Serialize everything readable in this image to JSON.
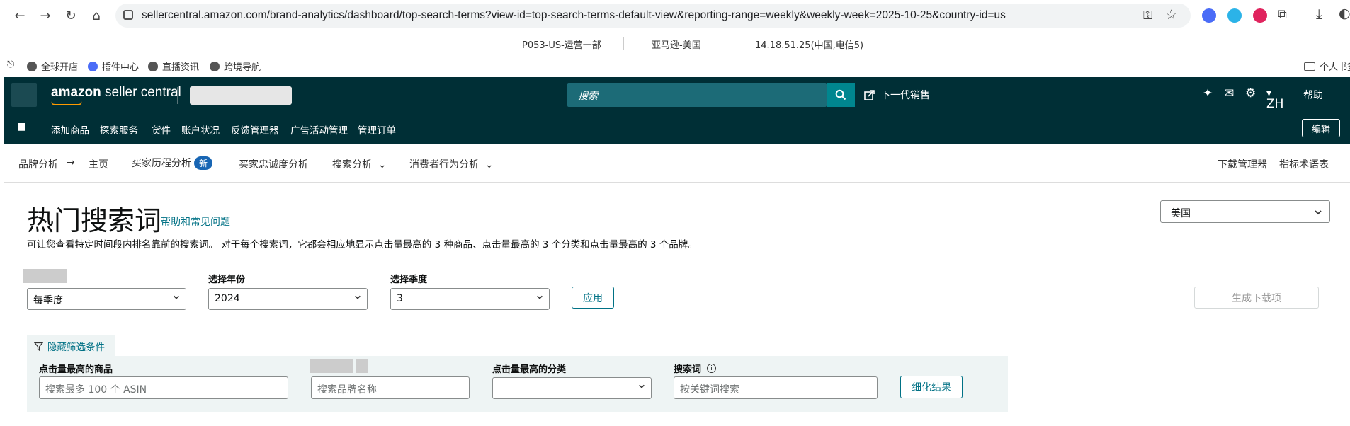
{
  "browser": {
    "url": "sellercentral.amazon.com/brand-analytics/dashboard/top-search-terms?view-id=top-search-terms-default-view&reporting-range=weekly&weekly-week=2025-10-25&country-id=us"
  },
  "infobar": {
    "account": "P053-US-运营一部",
    "marketplace": "亚马逊-美国",
    "ip": "14.18.51.25(中国,电信5)"
  },
  "bookmarks": {
    "items": [
      "全球开店",
      "插件中心",
      "直播资讯",
      "跨境导航"
    ],
    "right": "个人书签"
  },
  "header": {
    "logo_a": "amazon",
    "logo_b": " seller central",
    "search_placeholder": "搜索",
    "next_gen": "下一代销售",
    "lang": "ZH",
    "help": "帮助"
  },
  "nav": {
    "items": [
      "添加商品",
      "探索服务",
      "货件",
      "账户状况",
      "反馈管理器",
      "广告活动管理",
      "管理订单"
    ],
    "edit": "编辑"
  },
  "subnav": {
    "brand_analytics": "品牌分析",
    "home": "主页",
    "buyer_journey": "买家历程分析",
    "new_badge": "新",
    "loyalty": "买家忠诚度分析",
    "search_analysis": "搜索分析",
    "consumer_behavior": "消费者行为分析",
    "download_manager": "下载管理器",
    "glossary": "指标术语表"
  },
  "page": {
    "title": "热门搜索词",
    "help_link": "帮助和常见问题",
    "description": "可让您查看特定时间段内排名靠前的搜索词。 对于每个搜索词，它都会相应地显示点击量最高的 3 种商品、点击量最高的 3 个分类和点击量最高的 3 个品牌。",
    "country": "美国"
  },
  "filters": {
    "range_value": "每季度",
    "year_label": "选择年份",
    "year_value": "2024",
    "quarter_label": "选择季度",
    "quarter_value": "3",
    "apply": "应用",
    "generate_download": "生成下载项",
    "hide_filters": "隐藏筛选条件",
    "top_product_label": "点击量最高的商品",
    "top_product_placeholder": "搜索最多 100 个 ASIN",
    "brand_placeholder": "搜索品牌名称",
    "top_category_label": "点击量最高的分类",
    "search_term_label": "搜索词",
    "search_term_placeholder": "按关键词搜索",
    "refine": "细化结果"
  }
}
